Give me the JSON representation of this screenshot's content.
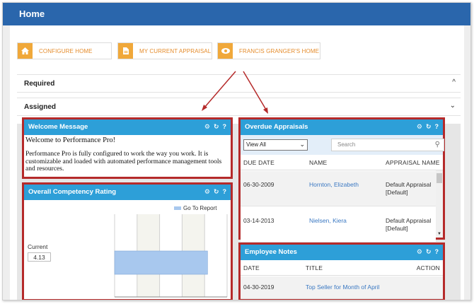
{
  "header": {
    "title": "Home"
  },
  "quick_buttons": [
    {
      "label": "CONFIGURE HOME",
      "icon": "home-icon"
    },
    {
      "label": "MY CURRENT APPRAISAL",
      "icon": "document-icon"
    },
    {
      "label": "FRANCIS GRANGER'S HOME",
      "icon": "eye-icon"
    }
  ],
  "sections": {
    "required": {
      "label": "Required",
      "state": "collapsed"
    },
    "assigned": {
      "label": "Assigned",
      "state": "expanded"
    }
  },
  "welcome": {
    "title": "Welcome Message",
    "heading": "Welcome to Performance Pro!",
    "body": "Performance Pro is fully configured to work the way you work. It is customizable and loaded with automated performance management tools and resources."
  },
  "competency": {
    "title": "Overall Competency Rating",
    "legend": "Go To Report",
    "current_label": "Current",
    "current_value": "4.13"
  },
  "chart_data": {
    "type": "bar",
    "orientation": "horizontal",
    "categories": [
      "Current"
    ],
    "series": [
      {
        "name": "Go To Report",
        "values": [
          4.13
        ]
      }
    ],
    "xlim": [
      0,
      5
    ],
    "xticks": [
      "0",
      "1",
      "2",
      "3",
      "4",
      "5"
    ],
    "grid": true,
    "legend_position": "top-right",
    "bar_color": "#a8c8ee"
  },
  "overdue": {
    "title": "Overdue Appraisals",
    "filter_value": "View All",
    "search_placeholder": "Search",
    "columns": [
      "DUE DATE",
      "NAME",
      "APPRAISAL NAME"
    ],
    "rows": [
      {
        "due_date": "06-30-2009",
        "name": "Hornton, Elizabeth",
        "appraisal": "Default Appraisal [Default]"
      },
      {
        "due_date": "03-14-2013",
        "name": "Nielsen, Kiera",
        "appraisal": "Default Appraisal [Default]"
      }
    ]
  },
  "notes": {
    "title": "Employee Notes",
    "columns": [
      "DATE",
      "TITLE",
      "ACTION"
    ],
    "rows": [
      {
        "date": "04-30-2019",
        "title": "Top Seller for Month of April"
      }
    ]
  },
  "colors": {
    "topbar": "#2a66ac",
    "widget_header": "#2d9fd8",
    "accent_orange": "#f0a83a",
    "highlight_red": "#b52a2a",
    "link": "#3a78c2"
  }
}
